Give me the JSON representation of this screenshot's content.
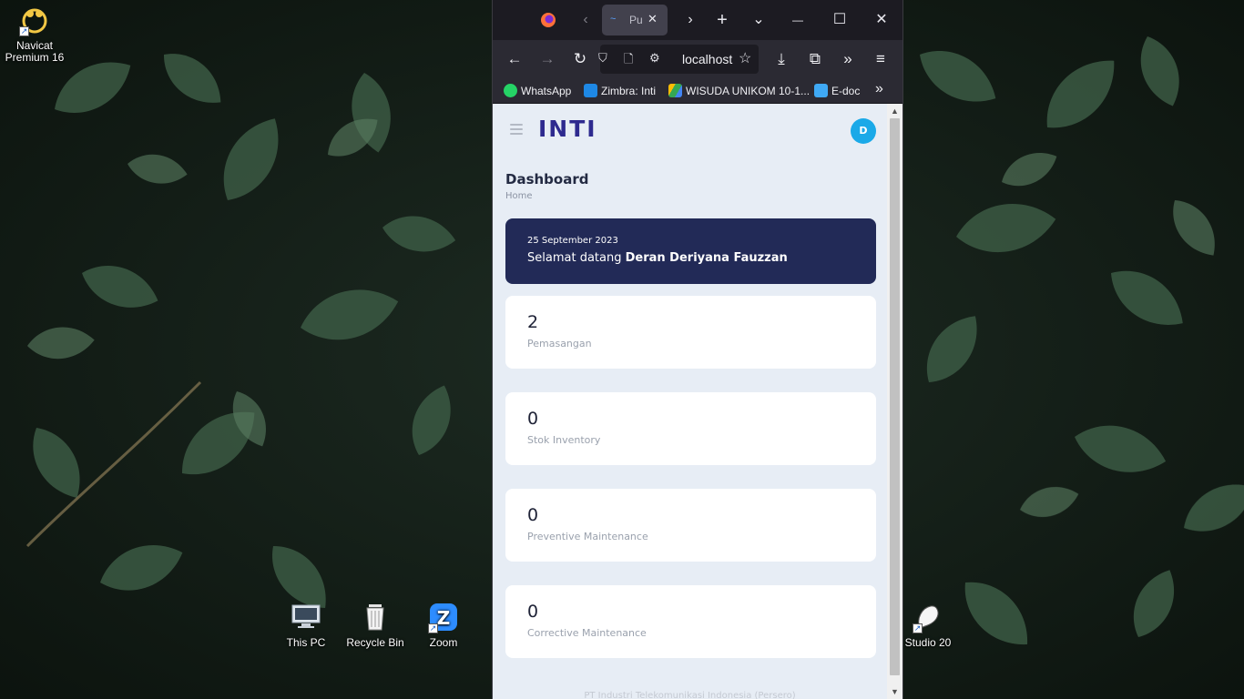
{
  "desktop": {
    "icons": [
      {
        "label_line1": "Navicat",
        "label_line2": "Premium 16",
        "icon": "navicat-icon"
      },
      {
        "label_line1": "This PC",
        "label_line2": "",
        "icon": "computer-icon"
      },
      {
        "label_line1": "Recycle Bin",
        "label_line2": "",
        "icon": "recycle-bin-icon"
      },
      {
        "label_line1": "Zoom",
        "label_line2": "",
        "icon": "zoom-icon"
      },
      {
        "label_line1": "Studio 20",
        "label_line2": "",
        "icon": "studio-icon"
      }
    ]
  },
  "browser": {
    "tab": {
      "title": "Pu",
      "favicon": "wave-icon"
    },
    "window_controls": {
      "minimize": "—",
      "maximize": "☐",
      "close": "✕"
    },
    "url": "localhost",
    "bookmarks": [
      {
        "label": "WhatsApp",
        "icon": "whatsapp-icon",
        "color": "#25d366"
      },
      {
        "label": "Zimbra: Inti",
        "icon": "zimbra-icon",
        "color": "#1e88e5"
      },
      {
        "label": "WISUDA UNIKOM 10-1...",
        "icon": "drive-icon",
        "color": "#fbbc04"
      },
      {
        "label": "E-doc",
        "icon": "folder-icon",
        "color": "#3fa9f5"
      }
    ]
  },
  "app": {
    "logo": "INTI",
    "avatar_initial": "D",
    "page_title": "Dashboard",
    "breadcrumb": "Home",
    "welcome": {
      "date": "25 September 2023",
      "greeting": "Selamat datang",
      "user_name": "Deran Deriyana Fauzzan"
    },
    "stats": [
      {
        "value": "2",
        "label": "Pemasangan"
      },
      {
        "value": "0",
        "label": "Stok Inventory"
      },
      {
        "value": "0",
        "label": "Preventive Maintenance"
      },
      {
        "value": "0",
        "label": "Corrective Maintenance"
      }
    ],
    "footer": "PT Industri Telekomunikasi Indonesia (Persero)"
  },
  "colors": {
    "welcome_bg": "#222a57",
    "avatar_bg": "#1aa9e8",
    "page_bg": "#e7edf5",
    "logo": "#2e2a8f"
  }
}
